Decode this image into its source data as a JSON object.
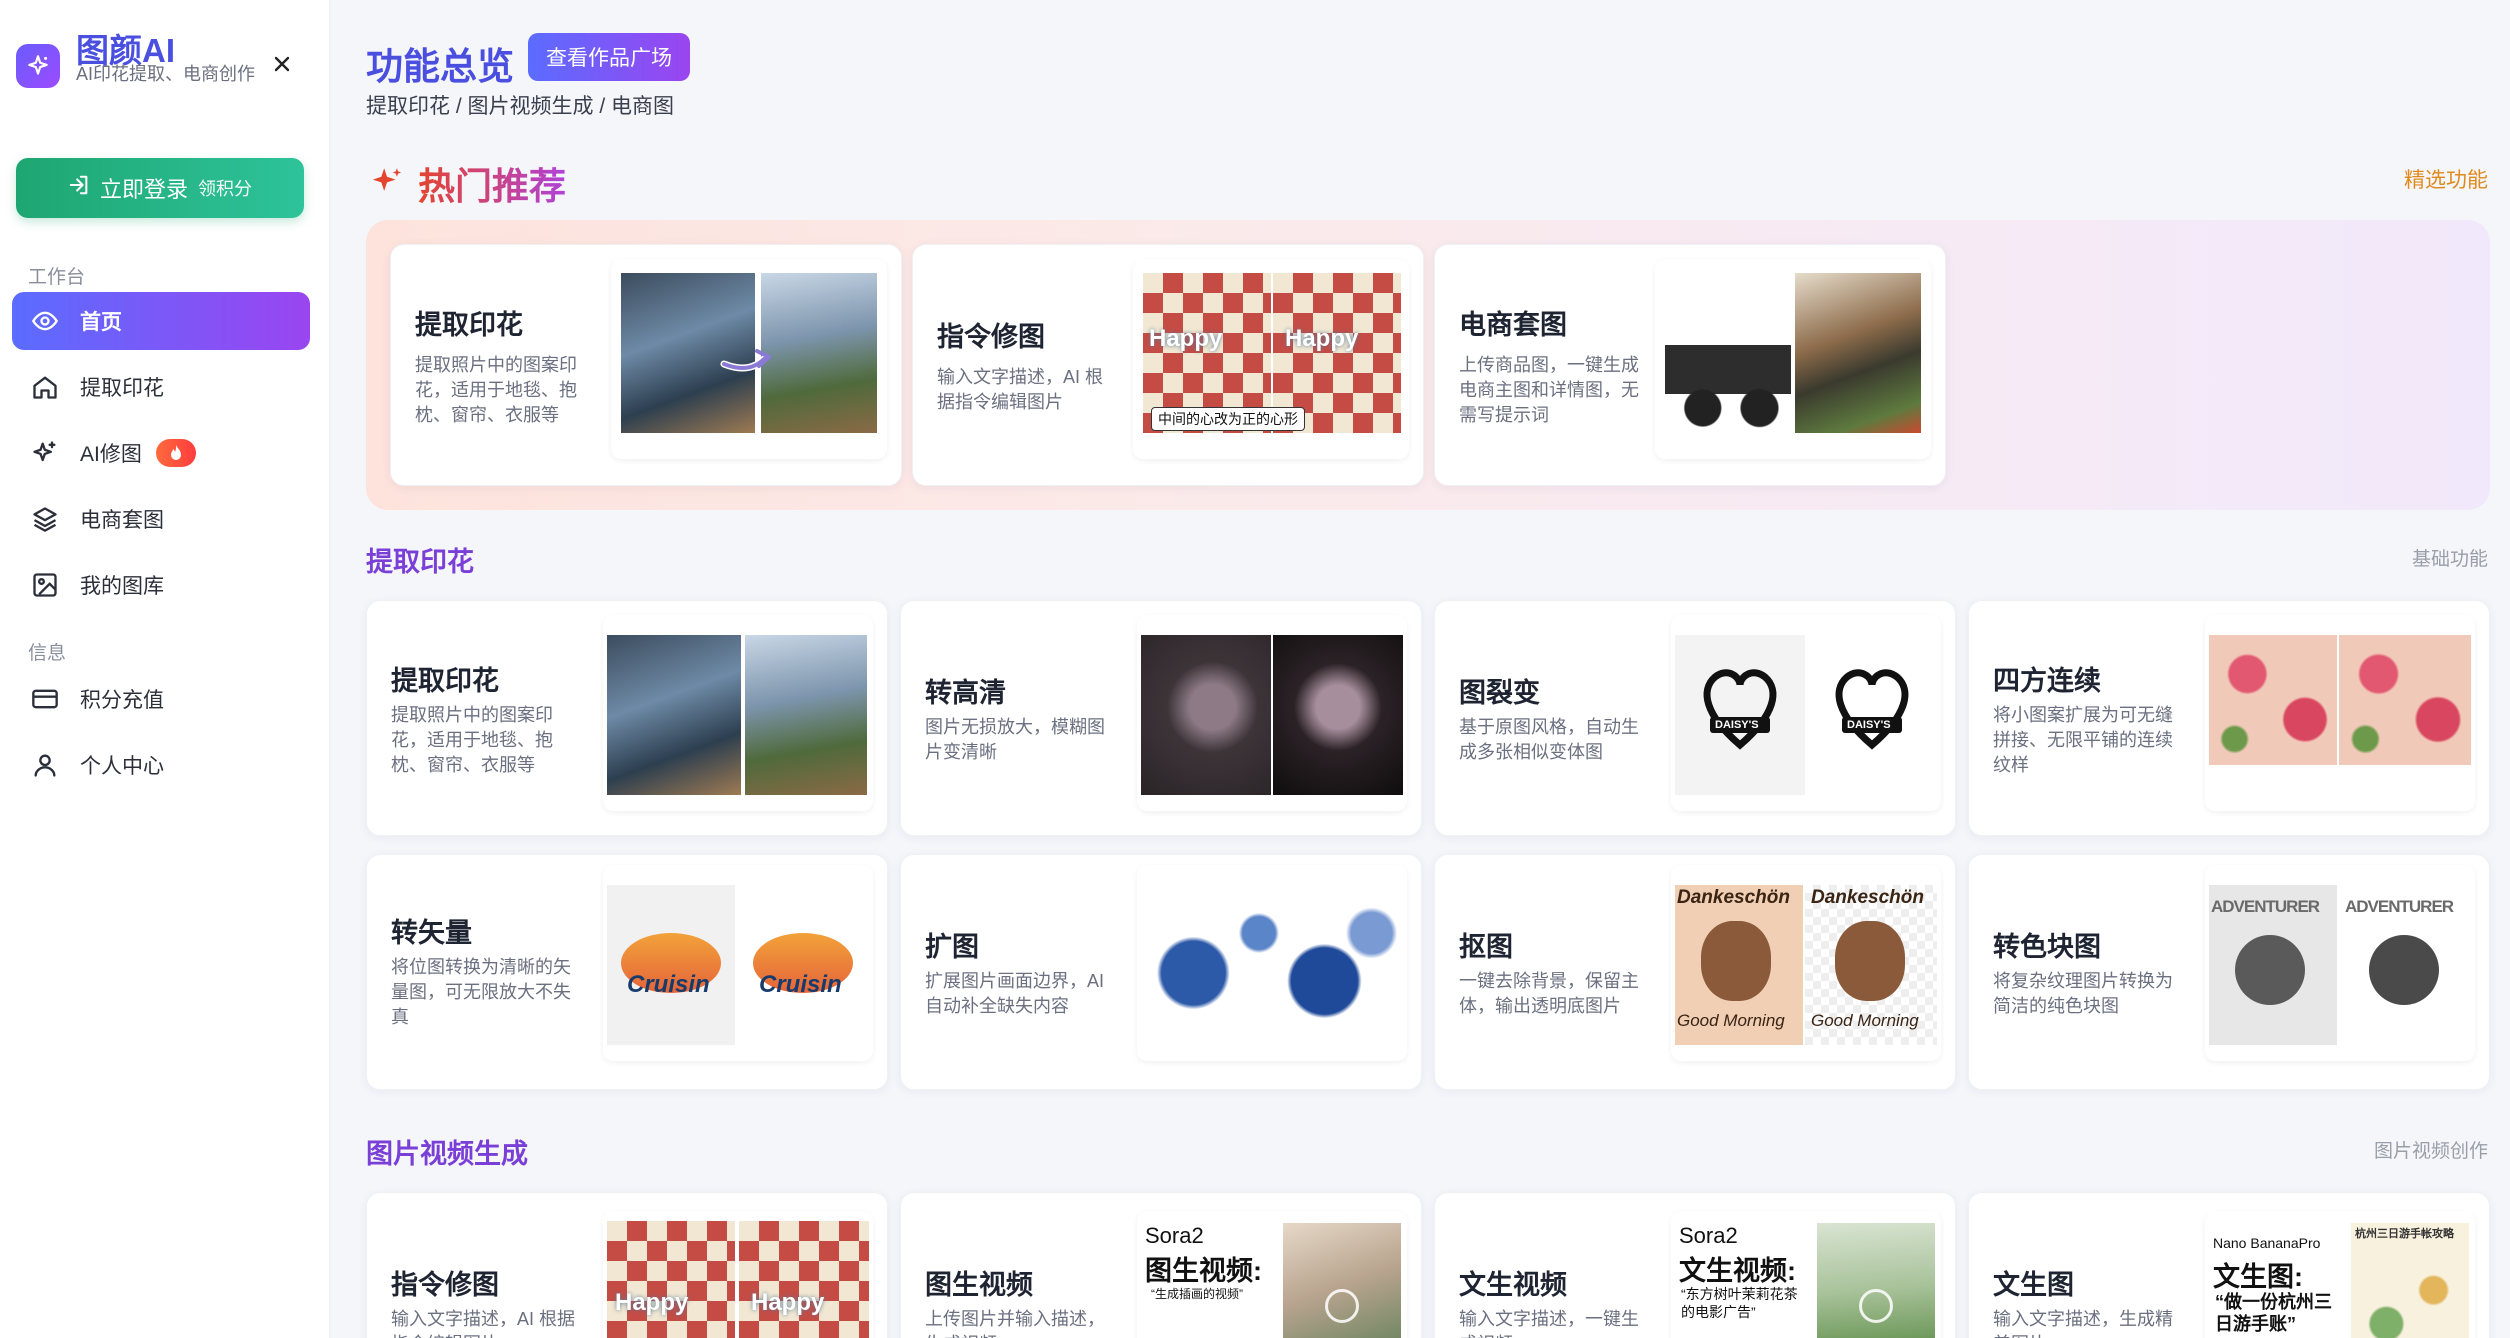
{
  "brand": {
    "title": "图颜AI",
    "subtitle": "AI印花提取、电商创作"
  },
  "login": {
    "label": "立即登录",
    "bonus": "领积分"
  },
  "sidebar": {
    "section_workbench": "工作台",
    "section_info": "信息",
    "items": [
      {
        "label": "首页",
        "icon": "eye-icon"
      },
      {
        "label": "提取印花",
        "icon": "home-icon"
      },
      {
        "label": "AI修图",
        "icon": "sparkle-icon"
      },
      {
        "label": "电商套图",
        "icon": "layers-icon"
      },
      {
        "label": "我的图库",
        "icon": "image-icon"
      },
      {
        "label": "积分充值",
        "icon": "card-icon"
      },
      {
        "label": "个人中心",
        "icon": "user-icon"
      }
    ]
  },
  "header": {
    "title": "功能总览",
    "gallery_button": "查看作品广场",
    "breadcrumb": "提取印花 / 图片视频生成 / 电商图"
  },
  "hot": {
    "title": "热门推荐",
    "right_label": "精选功能",
    "cards": [
      {
        "title": "提取印花",
        "desc": "提取照片中的图案印花，适用于地毯、抱枕、窗帘、衣服等"
      },
      {
        "title": "指令修图",
        "desc": "输入文字描述，AI 根据指令编辑图片",
        "caption": "中间的心改为正的心形",
        "thumb_text": "Happy"
      },
      {
        "title": "电商套图",
        "desc": "上传商品图，一键生成电商主图和详情图，无需写提示词"
      }
    ]
  },
  "extract": {
    "title": "提取印花",
    "right_label": "基础功能",
    "cards": [
      {
        "title": "提取印花",
        "desc": "提取照片中的图案印花，适用于地毯、抱枕、窗帘、衣服等"
      },
      {
        "title": "转高清",
        "desc": "图片无损放大，模糊图片变清晰"
      },
      {
        "title": "图裂变",
        "desc": "基于原图风格，自动生成多张相似变体图",
        "thumb_text": "DAISY'S"
      },
      {
        "title": "四方连续",
        "desc": "将小图案扩展为可无缝拼接、无限平铺的连续纹样"
      },
      {
        "title": "转矢量",
        "desc": "将位图转换为清晰的矢量图，可无限放大不失真",
        "thumb_text": "Cruisin"
      },
      {
        "title": "扩图",
        "desc": "扩展图片画面边界，AI 自动补全缺失内容"
      },
      {
        "title": "抠图",
        "desc": "一键去除背景，保留主体，输出透明底图片",
        "thumb_text": "Dankeschön",
        "thumb_text2": "Good Morning"
      },
      {
        "title": "转色块图",
        "desc": "将复杂纹理图片转换为简洁的纯色块图",
        "thumb_text": "ADVENTURER"
      }
    ]
  },
  "media": {
    "title": "图片视频生成",
    "right_label": "图片视频创作",
    "cards": [
      {
        "title": "指令修图",
        "desc": "输入文字描述，AI 根据指令编辑图片",
        "thumb_text": "Happy"
      },
      {
        "title": "图生视频",
        "desc": "上传图片并输入描述，生成视频",
        "thumb_line1": "Sora2",
        "thumb_line2": "图生视频:",
        "thumb_line3": "“生成插画的视频”"
      },
      {
        "title": "文生视频",
        "desc": "输入文字描述，一键生成视频",
        "thumb_line1": "Sora2",
        "thumb_line2": "文生视频:",
        "thumb_line3": "“东方树叶茉莉花茶的电影广告”"
      },
      {
        "title": "文生图",
        "desc": "输入文字描述，生成精美图片",
        "thumb_line1": "Nano BananaPro",
        "thumb_line2": "文生图:",
        "thumb_line3": "“做一份杭州三日游手账”",
        "thumb_side": "杭州三日游手帐攻略"
      }
    ]
  },
  "colors": {
    "accent": "#4a4fe0",
    "purple": "#9a45f0",
    "green": "#1ea672",
    "hot": "#e4452f"
  }
}
